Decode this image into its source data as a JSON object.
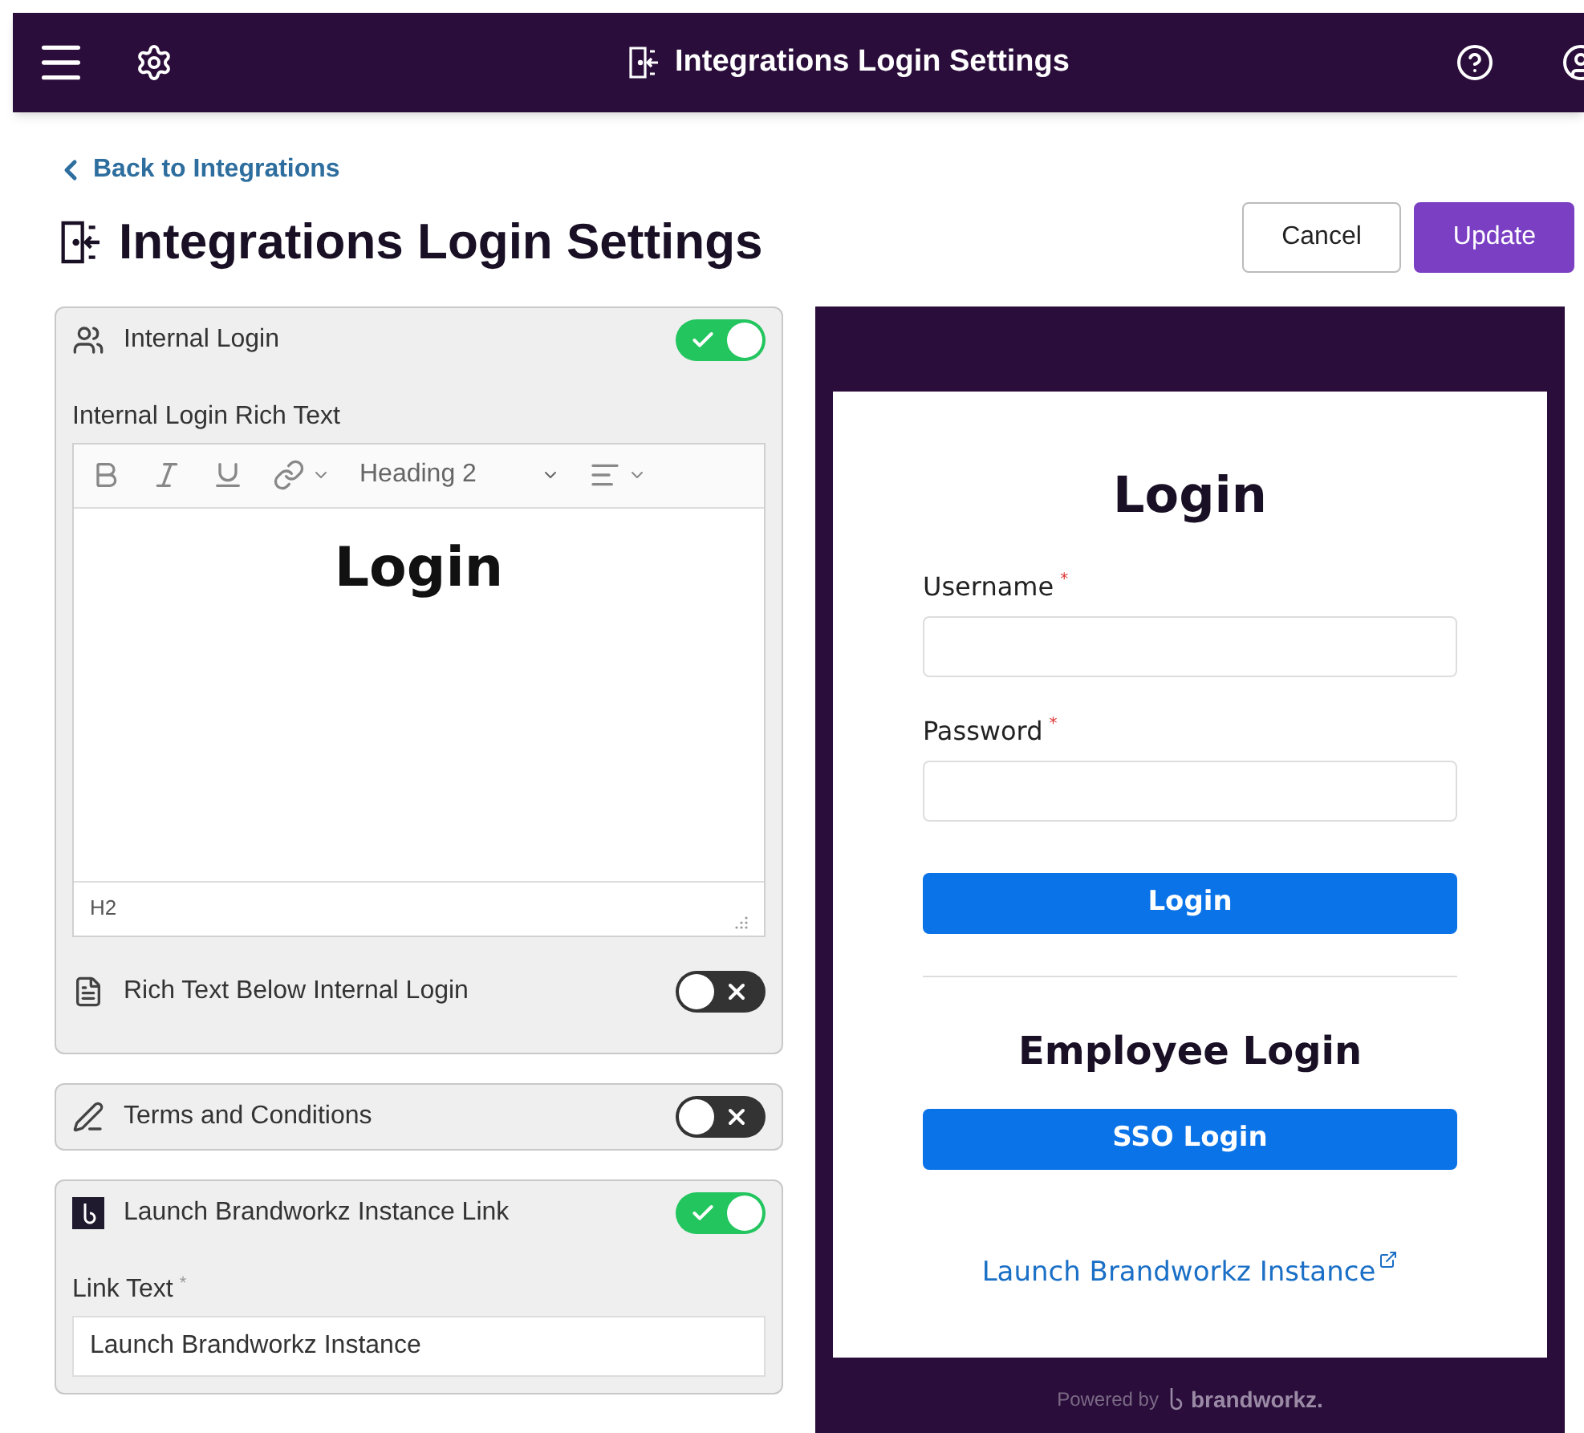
{
  "top_bar": {
    "title": "Integrations Login Settings"
  },
  "back_link": "Back to Integrations",
  "page_title": "Integrations Login Settings",
  "actions": [
    {
      "label": "Cancel",
      "kind": "secondary"
    },
    {
      "label": "Update",
      "kind": "primary"
    }
  ],
  "internal_login": {
    "title": "Internal Login",
    "on": true,
    "editor_label": "Internal Login Rich Text",
    "style_select": "Heading 2",
    "content": "Login",
    "status_path": "H2",
    "below": {
      "title": "Rich Text Below Internal Login",
      "on": false
    }
  },
  "terms": {
    "title": "Terms and Conditions",
    "on": false
  },
  "launch_link": {
    "title": "Launch Brandworkz Instance Link",
    "on": true,
    "field_label": "Link Text",
    "required_mark": "*",
    "value": "Launch Brandworkz Instance"
  },
  "preview": {
    "title": "Login",
    "fields": [
      {
        "label": "Username",
        "required_mark": "*"
      },
      {
        "label": "Password",
        "required_mark": "*"
      }
    ],
    "login_button": "Login",
    "sso_heading": "Employee Login",
    "sso_button": "SSO Login",
    "link": "Launch Brandworkz Instance",
    "footer_prefix": "Powered by",
    "footer_brand": "brandworkz."
  }
}
